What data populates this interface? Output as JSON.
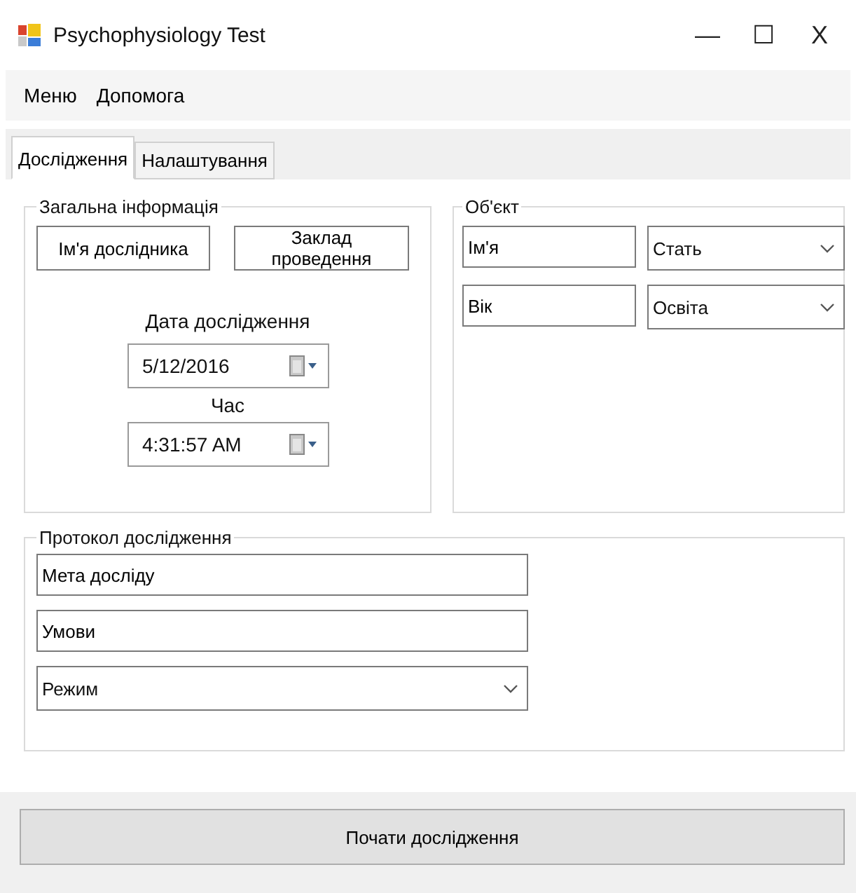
{
  "window": {
    "title": "Psychophysiology Test",
    "controls": [
      {
        "kind": "minimize",
        "label": "—"
      },
      {
        "kind": "maximize",
        "label": "☐"
      },
      {
        "kind": "close",
        "label": "X"
      }
    ]
  },
  "menu": [
    "Меню",
    "Допомога"
  ],
  "tabs": [
    {
      "label": "Дослідження",
      "selected": true
    },
    {
      "label": "Налаштування",
      "selected": false
    }
  ],
  "general": {
    "title": "Загальна інформація",
    "buttons": [
      "Ім'я дослідника",
      "Заклад проведення"
    ],
    "date_label": "Дата дослідження",
    "date_value": "5/12/2016",
    "time_label": "Час",
    "time_value": "4:31:57 AM"
  },
  "object": {
    "title": "Об'єкт",
    "fields": [
      {
        "kind": "text",
        "value": "Ім'я"
      },
      {
        "kind": "combo",
        "value": "Стать"
      },
      {
        "kind": "text",
        "value": "Вік"
      },
      {
        "kind": "combo",
        "value": "Освіта"
      }
    ]
  },
  "protocol": {
    "title": "Протокол дослідження",
    "fields": [
      {
        "kind": "text",
        "value": "Мета досліду"
      },
      {
        "kind": "text",
        "value": "Умови"
      },
      {
        "kind": "combo",
        "value": "Режим"
      }
    ]
  },
  "start_button": "Почати дослідження"
}
